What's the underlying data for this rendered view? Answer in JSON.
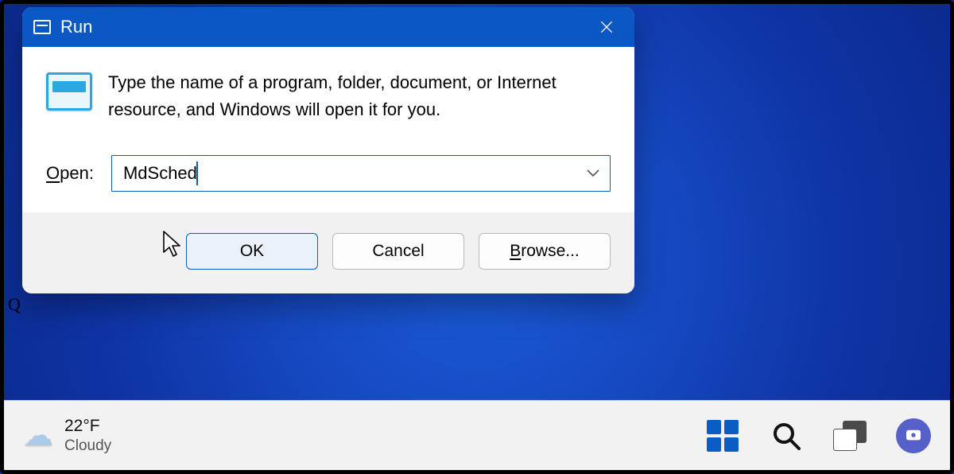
{
  "dialog": {
    "title": "Run",
    "description": "Type the name of a program, folder, document, or Internet resource, and Windows will open it for you.",
    "open_label_prefix": "O",
    "open_label_rest": "pen:",
    "input_value": "MdSched",
    "buttons": {
      "ok": "OK",
      "cancel": "Cancel",
      "browse_prefix": "B",
      "browse_rest": "rowse..."
    }
  },
  "taskbar": {
    "weather": {
      "temp": "22°F",
      "condition": "Cloudy"
    }
  }
}
